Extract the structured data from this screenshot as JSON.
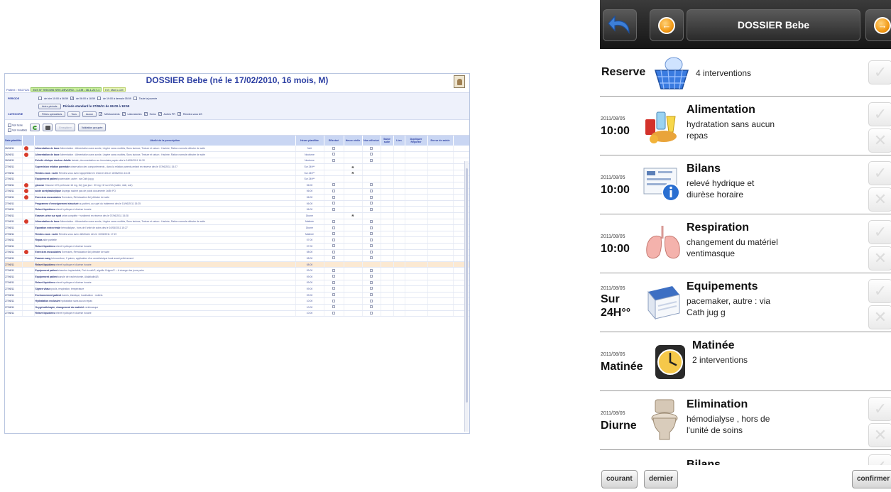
{
  "desktop": {
    "title": "DOSSIER Bebe (né le 17/02/2010, 16 mois, M)",
    "patient_label": "Patient : 9/527221",
    "patient_chip": "EdS N° 9/9/0396 SRV-DEVORD - 1-CM - 36-1-217-1",
    "patient_chip2": "Inf : Mat 1-CM",
    "periode_label": "PERIODE",
    "periode_opts": [
      "de hier 10:00 à 06:59",
      "de 06:00 à 18:59",
      "de 19:00 à demain 05:59",
      "Toute la journée"
    ],
    "autre_periode": "Autre période",
    "periode_standard": "Période standard  le  27/06/11  de 06:00  à 18:59",
    "categorie_label": "CATEGORIE",
    "filtres_btn": "Filtres spécialisés",
    "tous_btn": "Tous",
    "aucun_btn": "Aucun",
    "categories": [
      "Médicaments",
      "Laboratoires",
      "Soins",
      "Autres PR",
      "Rendez-vous AS"
    ],
    "voir_texte": "Voir texte",
    "voir_invalides": "Voir invalidés",
    "enregistrer_btn": "Enregistrer",
    "validation_btn": "Validation groupée",
    "columns": [
      "Date planifiée",
      "Libellé de la prescription",
      "Heure planifiée",
      "Effectué",
      "Heure réelle",
      "Non effectué",
      "Saisir suite",
      "Lien",
      "Dupliquer Reporter",
      "Erreur de saisie"
    ],
    "rows": [
      {
        "date": "26/06/11",
        "alert": true,
        "lib": "Alimentation de base",
        "rest": "Alimentation : Alimentation sans sonde, Légère sans crudités, Sans lactose, Texture et raison : Hachée, Ration normale débuter de suite",
        "hr": "Nuit",
        "eff": true,
        "real": "",
        "non": true,
        "hl": false
      },
      {
        "date": "26/06/11",
        "alert": true,
        "lib": "Alimentation de base",
        "rest": "Alimentation : Alimentation sans sonde, Légère sans crudités, Sans lactose, Texture et raison : Hachée, Ration normale débuter de suite",
        "hr": "Nocturne",
        "eff": true,
        "real": "",
        "non": true,
        "hl": false
      },
      {
        "date": "26/06/11",
        "alert": false,
        "lib": "Echelle clinique douleur Adulte",
        "rest": "faciale, documentation sur formulaire papier  dès le 16/06/2011 16:30",
        "hr": "Nocturne",
        "eff": true,
        "real": "",
        "non": true,
        "hl": false
      },
      {
        "date": "27/06/11",
        "alert": false,
        "lib": "Supervision relation parentale",
        "rest": "observation des comportements , dans la relation parents-enfant en réserve  dès le 07/06/2011 15:27",
        "hr": "Sur 24H**",
        "eff": false,
        "real": "R",
        "non": false,
        "hl": false
      },
      {
        "date": "27/06/11",
        "alert": false,
        "lib": "Rendez-vous : autre",
        "rest": "Rendez-vous avec logopédiste en réserve  dès le 16/06/2011 16:23",
        "hr": "Sur 24H**",
        "eff": false,
        "real": "R",
        "non": false,
        "hl": false
      },
      {
        "date": "27/06/11",
        "alert": false,
        "lib": "Equipement patient",
        "rest": "pacemaker, autre : via Cath jug g",
        "hr": "Sur 24H**",
        "eff": false,
        "real": "",
        "non": false,
        "hl": false
      },
      {
        "date": "27/06/11",
        "alert": true,
        "lib": "glucose",
        "rest": "Glucose 10% perfusion 16 mg, 3x/j  (par jour : 30 mg / 6/ sur 24h (matin, midi, soir)",
        "hr": "06:00",
        "eff": true,
        "real": "",
        "non": true,
        "hl": false
      },
      {
        "date": "27/06/11",
        "alert": true,
        "lib": "acide acétylsalicylique",
        "rest": "Aspégic sachet  pas de poids documenté  1x/8h  PO",
        "hr": "06:00",
        "eff": true,
        "real": "",
        "non": true,
        "hl": false
      },
      {
        "date": "27/06/11",
        "alert": true,
        "lib": "Exercices musculaires",
        "rest": "Exercices, Rééducation 6x/j  débuter de suite",
        "hr": "06:00",
        "eff": true,
        "real": "",
        "non": true,
        "hl": false
      },
      {
        "date": "27/06/11",
        "alert": false,
        "lib": "Programme d'enseignement structuré",
        "rest": "au patient, au sujet du traitement  dès le 10/06/2011 15:25",
        "hr": "06:00",
        "eff": true,
        "real": "",
        "non": true,
        "hl": false
      },
      {
        "date": "27/06/11",
        "alert": false,
        "lib": "Relevé liquidiens",
        "rest": "relevé hydrique et diurèse horaire",
        "hr": "06:00",
        "eff": true,
        "real": "",
        "non": true,
        "hl": false
      },
      {
        "date": "27/06/11",
        "alert": false,
        "lib": "Examen urine sur spot",
        "rest": "urine complète + sédiment en réserve  dès le 07/06/2011 15:28",
        "hr": "Diurne",
        "eff": false,
        "real": "R",
        "non": false,
        "hl": false
      },
      {
        "date": "27/06/11",
        "alert": true,
        "lib": "Alimentation de base",
        "rest": "Alimentation : Alimentation sans sonde, Légère sans crudités, Sans lactose, Texture et raison : Hachée, Ration normale débuter de suite",
        "hr": "Matinée",
        "eff": true,
        "real": "",
        "non": true,
        "hl": false
      },
      {
        "date": "27/06/11",
        "alert": false,
        "lib": "Epuration extra rénale",
        "rest": "hémodialyse , hors de l'unité de soins  dès le 10/06/2011 15:27",
        "hr": "Diurne",
        "eff": true,
        "real": "",
        "non": true,
        "hl": false
      },
      {
        "date": "27/06/11",
        "alert": false,
        "lib": "Rendez-vous : autre",
        "rest": "Rendez-vous avec diététicien  dès le 10/06/2011 17:19",
        "hr": "Matinée",
        "eff": true,
        "real": "",
        "non": true,
        "hl": false
      },
      {
        "date": "27/06/11",
        "alert": false,
        "lib": "Repas",
        "rest": "aide partielle",
        "hr": "07:00",
        "eff": true,
        "real": "",
        "non": true,
        "hl": false
      },
      {
        "date": "27/06/11",
        "alert": false,
        "lib": "Relevé liquidiens",
        "rest": "relevé hydrique et diurèse horaire",
        "hr": "07:00",
        "eff": true,
        "real": "",
        "non": true,
        "hl": false
      },
      {
        "date": "27/06/11",
        "alert": true,
        "lib": "Exercices musculaires",
        "rest": "Exercices, Rééducation 6x/j  débuter de suite",
        "hr": "08:00",
        "eff": true,
        "real": "",
        "non": true,
        "hl": false
      },
      {
        "date": "27/06/11",
        "alert": false,
        "lib": "Examen sang",
        "rest": "hémoculture, 2 paires, application d'un anesthésique local avant prélèvement",
        "hr": "08:00",
        "eff": true,
        "real": "",
        "non": true,
        "hl": false
      },
      {
        "date": "27/06/11",
        "alert": false,
        "lib": "Relevé liquidiens",
        "rest": "relevé hydrique et diurèse horaire",
        "hr": "08:00",
        "eff": false,
        "real": "",
        "non": false,
        "hl": true
      },
      {
        "date": "27/06/11",
        "alert": false,
        "lib": "Equipement patient",
        "rest": "chambre implantable, Port-à-cath®, aiguille Gripper® -- A changer les jours pairs",
        "hr": "09:00",
        "eff": true,
        "real": "",
        "non": true,
        "hl": false
      },
      {
        "date": "27/06/11",
        "alert": false,
        "lib": "Equipement patient",
        "rest": "canule de trachéotomie, Alalalkalin&B",
        "hr": "09:00",
        "eff": true,
        "real": "",
        "non": true,
        "hl": false
      },
      {
        "date": "27/06/11",
        "alert": false,
        "lib": "Relevé liquidiens",
        "rest": "relevé hydrique et diurèse horaire",
        "hr": "09:00",
        "eff": true,
        "real": "",
        "non": true,
        "hl": false
      },
      {
        "date": "27/06/11",
        "alert": false,
        "lib": "Signes vitaux",
        "rest": "pouls, respiration, température",
        "hr": "09:00",
        "eff": true,
        "real": "",
        "non": true,
        "hl": false
      },
      {
        "date": "27/06/11",
        "alert": false,
        "lib": "Environnement patient",
        "rest": "barrés, élastique, localisation : mollets",
        "hr": "09:00",
        "eff": true,
        "real": "",
        "non": true,
        "hl": false
      },
      {
        "date": "27/06/11",
        "alert": false,
        "lib": "Hydratation exclusive",
        "rest": "hydratation sans aucun repas",
        "hr": "10:00",
        "eff": true,
        "real": "",
        "non": true,
        "hl": false
      },
      {
        "date": "27/06/11",
        "alert": false,
        "lib": "Oxygénothérapie, changement du matériel",
        "rest": "ventimasque",
        "hr": "10:00",
        "eff": true,
        "real": "",
        "non": true,
        "hl": false
      },
      {
        "date": "27/06/11",
        "alert": false,
        "lib": "Relevé liquidiens",
        "rest": "relevé hydrique et diurèse horaire",
        "hr": "10:00",
        "eff": true,
        "real": "",
        "non": true,
        "hl": false
      }
    ]
  },
  "mobile": {
    "title": "DOSSIER Bebe",
    "items": [
      {
        "kind": "reserve",
        "title": "Reserve",
        "desc": "4 interventions"
      },
      {
        "kind": "task",
        "date": "2011/08/05",
        "time": "10:00",
        "title": "Alimentation",
        "desc1": "hydratation sans aucun",
        "desc2": "repas",
        "icon": "food-icon"
      },
      {
        "kind": "task",
        "date": "2011/08/05",
        "time": "10:00",
        "title": "Bilans",
        "desc1": "relevé hydrique et",
        "desc2": "diurèse horaire",
        "icon": "chart-info-icon"
      },
      {
        "kind": "task",
        "date": "2011/08/05",
        "time": "10:00",
        "title": "Respiration",
        "desc1": "changement du matériel",
        "desc2": "ventimasque",
        "icon": "lungs-icon"
      },
      {
        "kind": "task",
        "date": "2011/08/05",
        "time1": "Sur",
        "time2": "24H°°",
        "title": "Equipements",
        "desc1": "pacemaker, autre : via",
        "desc2": "Cath jug g",
        "icon": "equipment-box-icon"
      },
      {
        "kind": "group",
        "date": "2011/08/05",
        "time": "Matinée",
        "title": "Matinée",
        "desc": "2 interventions",
        "icon": "clock-icon"
      },
      {
        "kind": "task",
        "date": "2011/08/05",
        "time": "Diurne",
        "title": "Elimination",
        "desc1": "hémodialyse , hors de",
        "desc2": "l'unité de soins",
        "icon": "toilet-icon"
      },
      {
        "kind": "partial",
        "title": "Bilans"
      }
    ],
    "buttons": {
      "courant": "courant",
      "dernier": "dernier",
      "confirmer": "confirmer"
    }
  }
}
